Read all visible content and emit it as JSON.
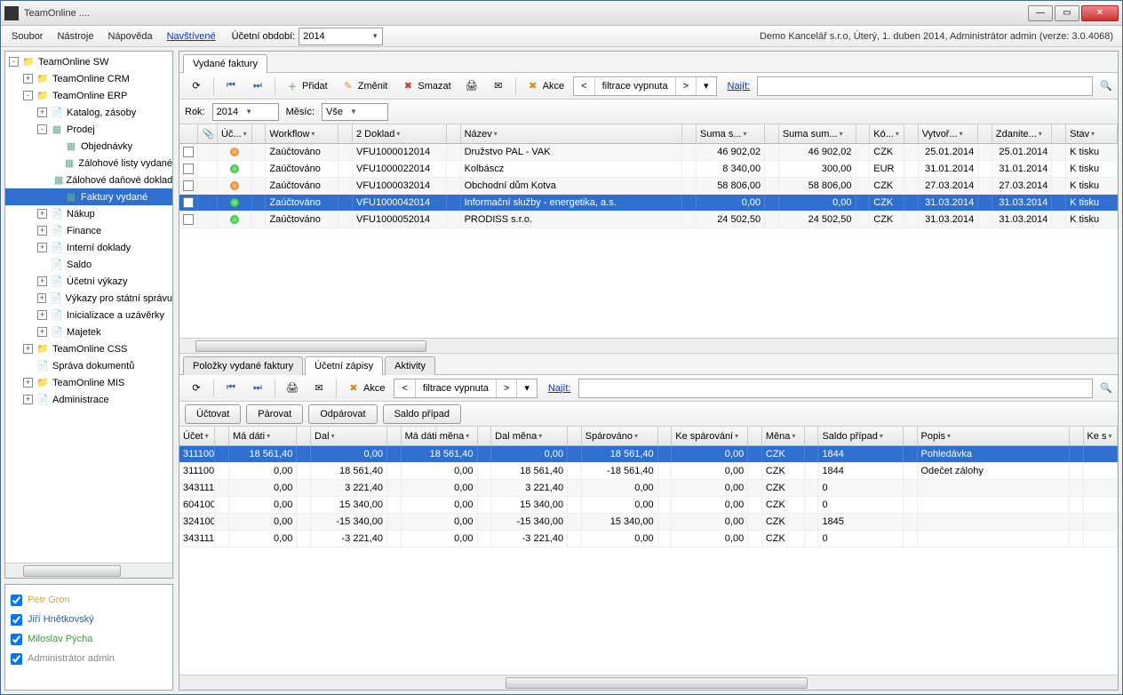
{
  "window": {
    "title": "TeamOnline ...."
  },
  "menu": {
    "items": [
      "Soubor",
      "Nástroje",
      "Nápověda"
    ],
    "visited": "Navštívené",
    "period_label": "Účetní období:",
    "period_value": "2014",
    "right_text": "Demo Kancelář s.r.o, Úterý, 1. duben 2014, Administrátor admin (verze: 3.0.4068)"
  },
  "tree": [
    {
      "d": 0,
      "e": "-",
      "i": "folder",
      "t": "TeamOnline SW"
    },
    {
      "d": 1,
      "e": "+",
      "i": "folder",
      "t": "TeamOnline CRM"
    },
    {
      "d": 1,
      "e": "-",
      "i": "folder",
      "t": "TeamOnline ERP"
    },
    {
      "d": 2,
      "e": "+",
      "i": "doc",
      "t": "Katalog, zásoby"
    },
    {
      "d": 2,
      "e": "-",
      "i": "grid",
      "t": "Prodej"
    },
    {
      "d": 3,
      "e": "",
      "i": "grid",
      "t": "Objednávky"
    },
    {
      "d": 3,
      "e": "",
      "i": "grid",
      "t": "Zálohové listy vydané"
    },
    {
      "d": 3,
      "e": "",
      "i": "grid",
      "t": "Zálohové daňové doklady"
    },
    {
      "d": 3,
      "e": "",
      "i": "grid",
      "t": "Faktury vydané",
      "sel": true
    },
    {
      "d": 2,
      "e": "+",
      "i": "doc",
      "t": "Nákup"
    },
    {
      "d": 2,
      "e": "+",
      "i": "doc",
      "t": "Finance"
    },
    {
      "d": 2,
      "e": "+",
      "i": "doc",
      "t": "Interní doklady"
    },
    {
      "d": 2,
      "e": "",
      "i": "doc",
      "t": "Saldo"
    },
    {
      "d": 2,
      "e": "+",
      "i": "doc",
      "t": "Účetní výkazy"
    },
    {
      "d": 2,
      "e": "+",
      "i": "doc",
      "t": "Výkazy pro státní správu"
    },
    {
      "d": 2,
      "e": "+",
      "i": "doc",
      "t": "Inicializace a uzávěrky"
    },
    {
      "d": 2,
      "e": "+",
      "i": "doc",
      "t": "Majetek"
    },
    {
      "d": 1,
      "e": "+",
      "i": "folder",
      "t": "TeamOnline CSS"
    },
    {
      "d": 1,
      "e": "",
      "i": "doc",
      "t": "Správa dokumentů"
    },
    {
      "d": 1,
      "e": "+",
      "i": "folder",
      "t": "TeamOnline MIS"
    },
    {
      "d": 1,
      "e": "+",
      "i": "doc",
      "t": "Administrace"
    }
  ],
  "users": [
    "Petr Gron",
    "Jiří Hnětkovský",
    "Miloslav Pýcha",
    "Administrátor admin"
  ],
  "upper": {
    "tab": "Vydané faktury",
    "toolbar": {
      "add": "Přidat",
      "edit": "Změnit",
      "del": "Smazat",
      "actions": "Akce",
      "filter_off": "filtrace vypnuta",
      "find": "Najít:"
    },
    "year_label": "Rok:",
    "year": "2014",
    "month_label": "Měsíc:",
    "month": "Vše",
    "columns": [
      "",
      "",
      "Úč...",
      "",
      "Workflow",
      "",
      "2 Doklad",
      "",
      "Název",
      "",
      "Suma s...",
      "",
      "Suma sum...",
      "",
      "Kó...",
      "",
      "Vytvoř...",
      "",
      "Zdanite...",
      "",
      "Stav"
    ],
    "rows": [
      {
        "dot": "orange",
        "wf": "Zaúčtováno",
        "doc": "VFU1000012014",
        "name": "Družstvo PAL - VAK",
        "s1": "46 902,02",
        "s2": "46 902,02",
        "cur": "CZK",
        "d1": "25.01.2014",
        "d2": "25.01.2014",
        "stav": "K tisku"
      },
      {
        "dot": "green",
        "wf": "Zaúčtováno",
        "doc": "VFU1000022014",
        "name": "Kolbáscz",
        "s1": "8 340,00",
        "s2": "300,00",
        "cur": "EUR",
        "d1": "31.01.2014",
        "d2": "31.01.2014",
        "stav": "K tisku"
      },
      {
        "dot": "orange",
        "wf": "Zaúčtováno",
        "doc": "VFU1000032014",
        "name": "Obchodní dům Kotva",
        "s1": "58 806,00",
        "s2": "58 806,00",
        "cur": "CZK",
        "d1": "27.03.2014",
        "d2": "27.03.2014",
        "stav": "K tisku"
      },
      {
        "dot": "green",
        "wf": "Zaúčtováno",
        "doc": "VFU1000042014",
        "name": "Informační služby - energetika, a.s.",
        "s1": "0,00",
        "s2": "0,00",
        "cur": "CZK",
        "d1": "31.03.2014",
        "d2": "31.03.2014",
        "stav": "K tisku",
        "sel": true
      },
      {
        "dot": "green",
        "wf": "Zaúčtováno",
        "doc": "VFU1000052014",
        "name": "PRODISS s.r.o.",
        "s1": "24 502,50",
        "s2": "24 502,50",
        "cur": "CZK",
        "d1": "31.03.2014",
        "d2": "31.03.2014",
        "stav": "K tisku"
      }
    ]
  },
  "lower": {
    "tabs": [
      "Položky vydané faktury",
      "Účetní zápisy",
      "Aktivity"
    ],
    "active_tab": 1,
    "toolbar": {
      "actions": "Akce",
      "filter_off": "filtrace vypnuta",
      "find": "Najít:"
    },
    "buttons": [
      "Účtovat",
      "Párovat",
      "Odpárovat",
      "Saldo případ"
    ],
    "columns": [
      "Účet",
      "",
      "Má dáti",
      "",
      "Dal",
      "",
      "Má dáti měna",
      "",
      "Dal měna",
      "",
      "Spárováno",
      "",
      "Ke spárování",
      "",
      "Měna",
      "",
      "Saldo případ",
      "",
      "Popis",
      "",
      "Ke s"
    ],
    "rows": [
      {
        "u": "311100",
        "md": "18 561,40",
        "d": "0,00",
        "mdm": "18 561,40",
        "dm": "0,00",
        "sp": "18 561,40",
        "ks": "0,00",
        "m": "CZK",
        "sc": "1844",
        "p": "Pohledávka",
        "sel": true
      },
      {
        "u": "311100",
        "md": "0,00",
        "d": "18 561,40",
        "mdm": "0,00",
        "dm": "18 561,40",
        "sp": "-18 561,40",
        "ks": "0,00",
        "m": "CZK",
        "sc": "1844",
        "p": "Odečet zálohy"
      },
      {
        "u": "343111",
        "md": "0,00",
        "d": "3 221,40",
        "mdm": "0,00",
        "dm": "3 221,40",
        "sp": "0,00",
        "ks": "0,00",
        "m": "CZK",
        "sc": "0",
        "p": ""
      },
      {
        "u": "604100",
        "md": "0,00",
        "d": "15 340,00",
        "mdm": "0,00",
        "dm": "15 340,00",
        "sp": "0,00",
        "ks": "0,00",
        "m": "CZK",
        "sc": "0",
        "p": ""
      },
      {
        "u": "324100",
        "md": "0,00",
        "d": "-15 340,00",
        "mdm": "0,00",
        "dm": "-15 340,00",
        "sp": "15 340,00",
        "ks": "0,00",
        "m": "CZK",
        "sc": "1845",
        "p": ""
      },
      {
        "u": "343111",
        "md": "0,00",
        "d": "-3 221,40",
        "mdm": "0,00",
        "dm": "-3 221,40",
        "sp": "0,00",
        "ks": "0,00",
        "m": "CZK",
        "sc": "0",
        "p": ""
      }
    ]
  }
}
